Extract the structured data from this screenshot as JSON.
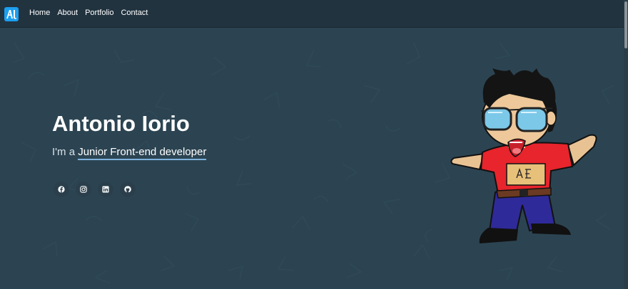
{
  "navbar": {
    "logo_text": "AI",
    "links": [
      "Home",
      "About",
      "Portfolio",
      "Contact"
    ]
  },
  "hero": {
    "name": "Antonio Iorio",
    "intro_prefix": "I'm a ",
    "typed_role": "Junior Front-end developer"
  },
  "socials": [
    {
      "icon": "facebook-icon"
    },
    {
      "icon": "instagram-icon"
    },
    {
      "icon": "linkedin-icon"
    },
    {
      "icon": "github-icon"
    }
  ],
  "colors": {
    "navbar_bg": "#223340",
    "hero_bg": "#2c4452",
    "logo_bg": "#1d9ff0",
    "accent_underline": "#7fb2dd"
  }
}
